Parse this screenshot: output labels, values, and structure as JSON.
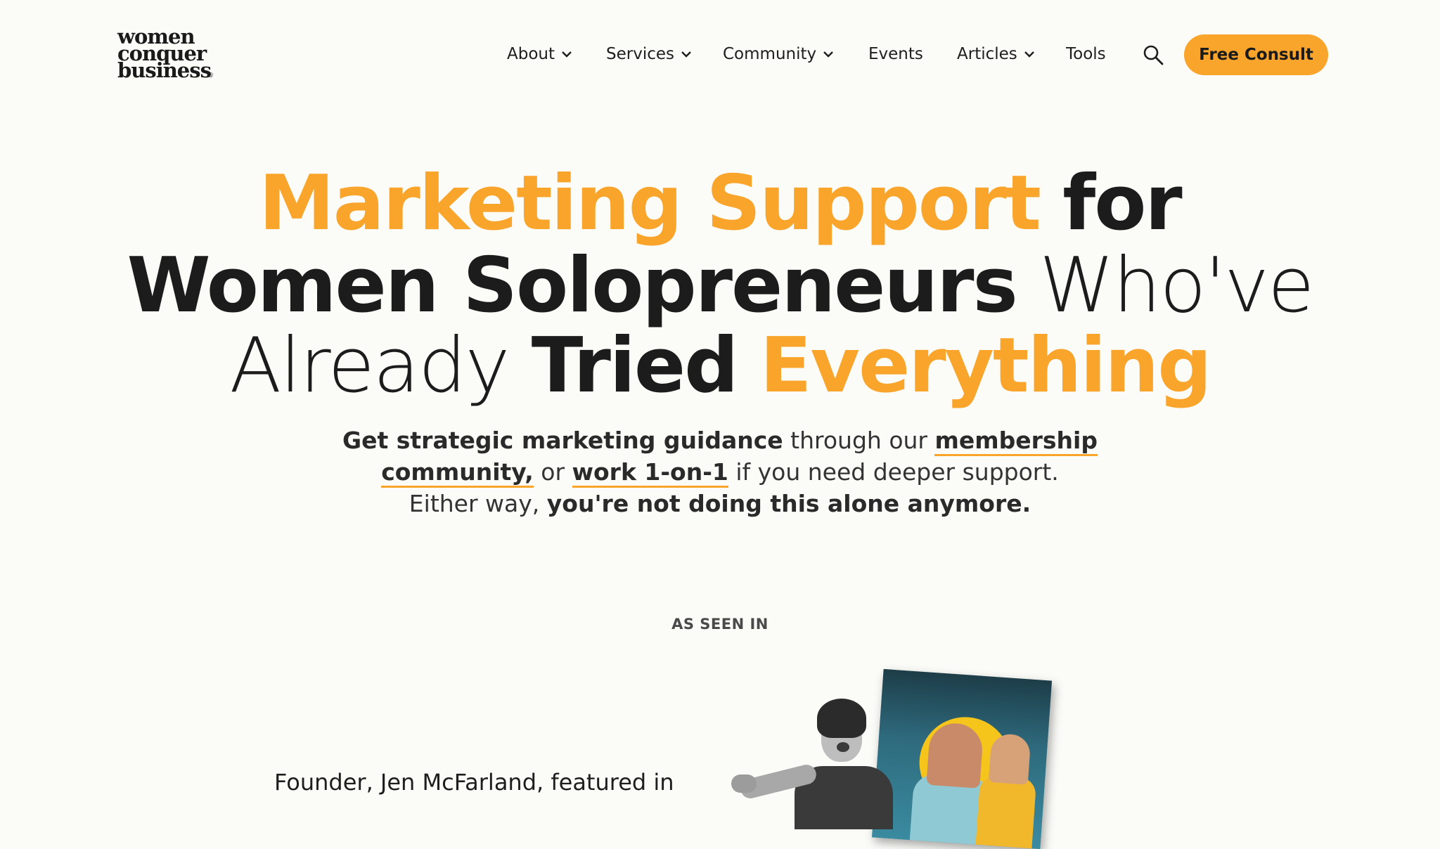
{
  "brand": {
    "logo_lines": [
      "women",
      "conquer",
      "business"
    ],
    "logo_mark": "®"
  },
  "nav": {
    "items": [
      {
        "label": "About",
        "has_dropdown": true
      },
      {
        "label": "Services",
        "has_dropdown": true
      },
      {
        "label": "Community",
        "has_dropdown": true
      },
      {
        "label": "Events",
        "has_dropdown": false
      },
      {
        "label": "Articles",
        "has_dropdown": true
      },
      {
        "label": "Tools",
        "has_dropdown": false
      }
    ],
    "search_icon": "search-icon",
    "cta_label": "Free Consult"
  },
  "hero": {
    "line1_orange": "Marketing Support",
    "line1_dark": "for",
    "line2_bold": "Women Solopreneurs",
    "line2_light": "Who've",
    "line3_light": "Already",
    "line3_bold": "Tried",
    "line3_orange": "Everything",
    "sub_p1_bold": "Get strategic marketing guidance",
    "sub_p1_text": " through our ",
    "sub_link1_a": "membership",
    "sub_link1_b": "community,",
    "sub_p2_text": " or ",
    "sub_link2": "work 1-on-1",
    "sub_p2_end": " if you need deeper support.",
    "sub_p3_text": "Either way, ",
    "sub_p3_bold": "you're not doing this alone anymore."
  },
  "as_seen_in": {
    "label": "AS SEEN IN"
  },
  "founder": {
    "text": "Founder, Jen McFarland, featured in"
  },
  "colors": {
    "accent": "#f9a42a",
    "background": "#fbfbf8",
    "text": "#1e1e1e"
  }
}
